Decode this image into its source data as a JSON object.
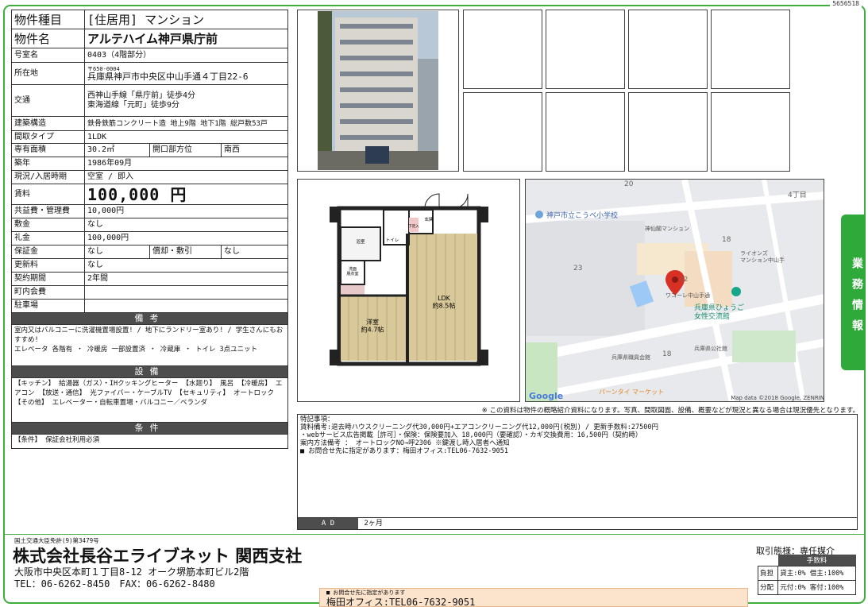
{
  "doc_id": "5656518",
  "spec": {
    "type_label": "物件種目",
    "type_value": "[住居用] マンション",
    "name_label": "物件名",
    "name_value": "アルテハイム神戸県庁前",
    "room_label": "号室名",
    "room_value": "0403（4階部分）",
    "address_label": "所在地",
    "postal": "〒650-0004",
    "address": "兵庫県神戸市中央区中山手通４丁目22-6",
    "access_label": "交通",
    "access1": "西神山手線「県庁前」徒歩4分",
    "access2": "東海道線「元町」徒歩9分",
    "structure_label": "建築構造",
    "structure_value": "鉄骨鉄筋コンクリート造 地上9階 地下1階 総戸数53戸",
    "layout_label": "間取タイプ",
    "layout_value": "1LDK",
    "area_label": "専有面積",
    "area_value": "30.2㎡",
    "direction_label": "開口部方位",
    "direction_value": "南西",
    "built_label": "築年",
    "built_value": "1986年09月",
    "status_label": "現況/入居時期",
    "status_value": "空室 / 即入",
    "rent_label": "賃料",
    "rent_value": "100,000 円",
    "fee_label": "共益費・管理費",
    "fee_value": "10,000円",
    "deposit_label": "敷金",
    "deposit_value": "なし",
    "key_label": "礼金",
    "key_value": "100,000円",
    "guarantee_label": "保証金",
    "guarantee_value": "なし",
    "amort_label": "償却・敷引",
    "amort_value": "なし",
    "renew_label": "更新料",
    "renew_value": "なし",
    "term_label": "契約期間",
    "term_value": "2年間",
    "assoc_label": "町内会費",
    "assoc_value": "",
    "parking_label": "駐車場",
    "parking_value": ""
  },
  "remarks": {
    "header": "備考",
    "text": "室内又はバルコニーに洗濯機置場設置! / 地下にランドリー室あり! / 学生さんにもおすすめ!\nエレベータ 各階有 ・ 冷暖房 一部設置済 ・ 冷蔵庫 ・ トイレ 3点ユニット"
  },
  "equipment": {
    "header": "設備",
    "text": "【キッチン】 給湯器（ガス）・IHクッキングヒーター 【水廻り】 風呂 【冷暖房】 エアコン 【放送・通信】 光ファイバー・ケーブルTV 【セキュリティ】 オートロック 【その他】 エレベーター・自転車置場・バルコニー／ベランダ"
  },
  "conditions": {
    "header": "条件",
    "text": "【条件】 保証会社利用必須"
  },
  "floorplan": {
    "bath": "浴室",
    "toilet": "トイレ",
    "wash": "洗面\n脱衣室",
    "entrance": "玄関",
    "shoes": "下足入",
    "western": "洋室\n約4.7帖",
    "ldk": "LDK\n約8.5帖"
  },
  "map": {
    "school": "神戸市立こうべ小学校",
    "mansion": "神仙閣マンション",
    "lions": "ライオンズ\nマンション中山手",
    "wacore": "ワコーレ中山手通",
    "hall": "兵庫県ひょうご\n女性交流館",
    "office": "兵庫県職員会館",
    "park": "兵庫県公社館",
    "market": "パーンタイ マーケット",
    "block4": "4丁目",
    "n20": "20",
    "n18a": "18",
    "n18b": "18",
    "n23": "23",
    "n22": "22",
    "google": "Google",
    "credit": "Map data ©2018 Google, ZENRIN"
  },
  "disclaimer": "※ この資料は物件の概略紹介資料になります。写真、間取図面、設備、概要などが現況と異なる場合は現況優先となります。",
  "special": {
    "text": "特記事項：\n賃料備考:退去時ハウスクリーニング代30,000円+エアコンクリーニング代12,000円(税別) / 更新手数料:27500円\n・webサービス広告掲載［許可］・保険：保険要加入 18,000円（要確認）・カギ交換費用：16,500円（契約時）\n案内方法備考 ： オートロックNO→呼2306 ※鍵渡し時入居者へ通知\n■ お問合せ先に指定があります：梅田オフィス:TEL06-7632-9051"
  },
  "ad": {
    "label": "A D",
    "value": "2ヶ月"
  },
  "side_tab": "業務情報",
  "company": {
    "license": "国土交通大臣免許(9)第3479号",
    "name": "株式会社長谷エライブネット 関西支社",
    "address": "大阪市中央区本町１丁目8-12 オーク堺筋本町ビル2階",
    "tel": "TEL：06-6262-8450　FAX：06-6262-8480"
  },
  "deal": {
    "type": "取引態様：専任媒介",
    "fee_header": "手数料",
    "burden_label": "負担",
    "burden_value": "貸主:0% 借主:100%",
    "split_label": "分配",
    "split_value": "元付:0% 客付:100%"
  },
  "contact": {
    "note": "■ お問合せ先に指定があります",
    "office": "梅田オフィス:TEL06-7632-9051"
  }
}
